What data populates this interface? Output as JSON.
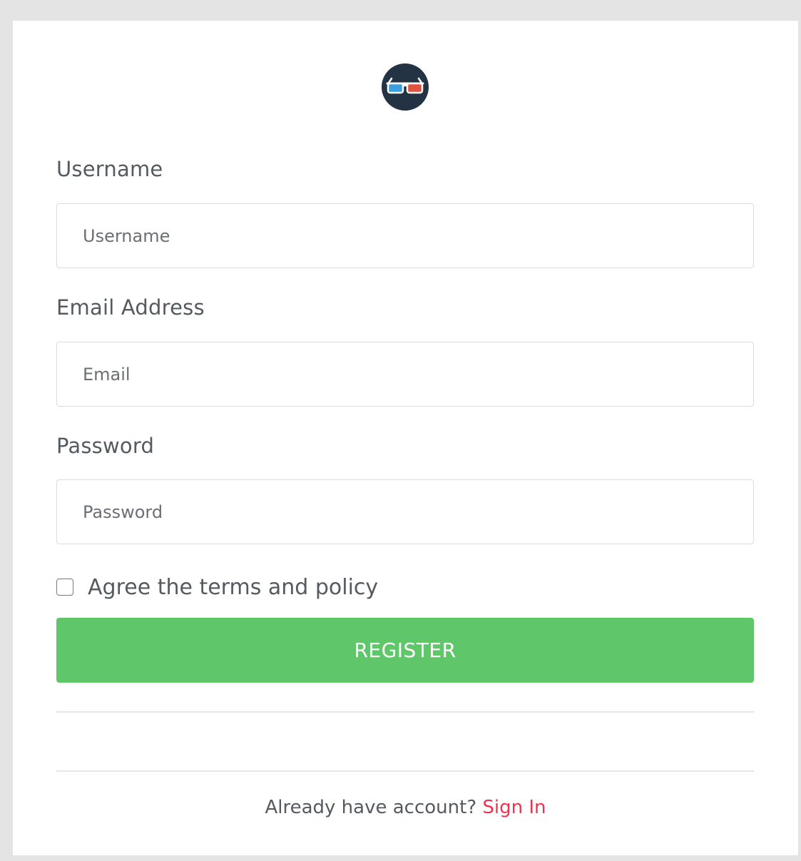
{
  "form": {
    "username": {
      "label": "Username",
      "placeholder": "Username"
    },
    "email": {
      "label": "Email Address",
      "placeholder": "Email"
    },
    "password": {
      "label": "Password",
      "placeholder": "Password"
    },
    "terms": {
      "label": "Agree the terms and policy",
      "checked": false
    },
    "register_label": "REGISTER"
  },
  "footer": {
    "prompt": "Already have account?",
    "signin_label": "Sign In"
  },
  "logo": {
    "icon": "3d-glasses-icon"
  },
  "colors": {
    "page_background": "#e4e4e4",
    "register_button": "#5fc66a",
    "link": "#f0334f",
    "logo_background": "#233343",
    "lens_left": "#3a9fe0",
    "lens_right": "#e0533f"
  }
}
